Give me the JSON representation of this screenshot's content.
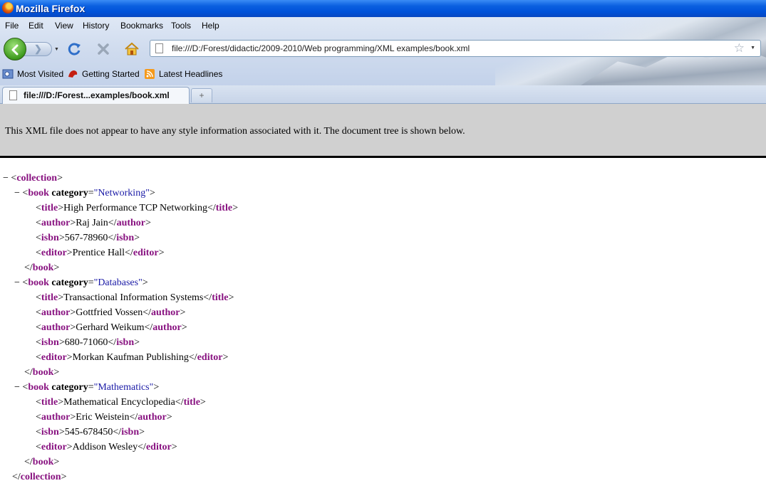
{
  "window": {
    "title": "Mozilla Firefox"
  },
  "menu": [
    "File",
    "Edit",
    "View",
    "History",
    "Bookmarks",
    "Tools",
    "Help"
  ],
  "toolbar": {
    "url": "file:///D:/Forest/didactic/2009-2010/Web programming/XML examples/book.xml"
  },
  "bookmarks": [
    "Most Visited",
    "Getting Started",
    "Latest Headlines"
  ],
  "tabs": [
    {
      "label": "file:///D:/Forest...examples/book.xml"
    }
  ],
  "newtab_label": "+",
  "info": {
    "message": "This XML file does not appear to have any style information associated with it. The document tree is shown below."
  },
  "xml": {
    "root_open": "collection",
    "root_close": "collection",
    "collapse_marker": "−",
    "books": [
      {
        "category": "Networking",
        "children": [
          {
            "tag": "title",
            "text": "High Performance TCP Networking"
          },
          {
            "tag": "author",
            "text": "Raj Jain"
          },
          {
            "tag": "isbn",
            "text": "567-78960"
          },
          {
            "tag": "editor",
            "text": "Prentice Hall"
          }
        ]
      },
      {
        "category": "Databases",
        "children": [
          {
            "tag": "title",
            "text": "Transactional Information Systems"
          },
          {
            "tag": "author",
            "text": "Gottfried Vossen"
          },
          {
            "tag": "author",
            "text": "Gerhard Weikum"
          },
          {
            "tag": "isbn",
            "text": "680-71060"
          },
          {
            "tag": "editor",
            "text": "Morkan Kaufman Publishing"
          }
        ]
      },
      {
        "category": "Mathematics",
        "children": [
          {
            "tag": "title",
            "text": "Mathematical Encyclopedia"
          },
          {
            "tag": "author",
            "text": "Eric Weistein"
          },
          {
            "tag": "isbn",
            "text": "545-678450"
          },
          {
            "tag": "editor",
            "text": "Addison Wesley"
          }
        ]
      }
    ],
    "book_tag": "book",
    "attr_name": "category"
  }
}
